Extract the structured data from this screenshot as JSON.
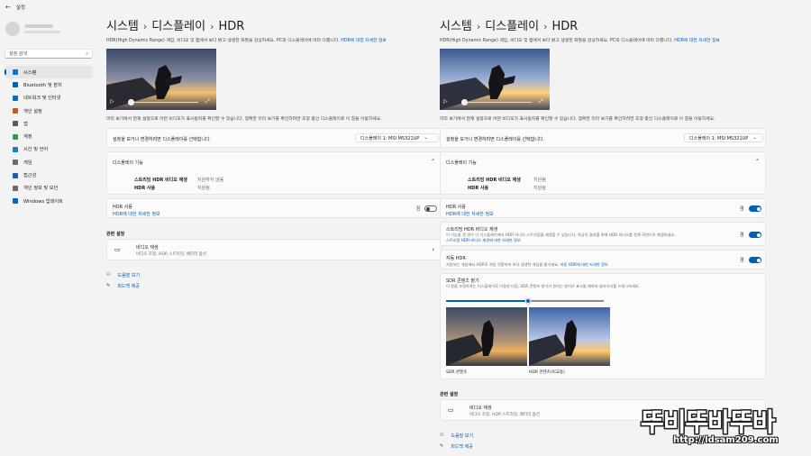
{
  "app": {
    "title": "설정"
  },
  "sidebar": {
    "search_placeholder": "설정 검색",
    "items": [
      {
        "label": "시스템",
        "icon": "system-icon",
        "color": "#0078d4"
      },
      {
        "label": "Bluetooth 및 장치",
        "icon": "bluetooth-icon",
        "color": "#0063b1"
      },
      {
        "label": "네트워크 및 인터넷",
        "icon": "network-icon",
        "color": "#0a6ebd"
      },
      {
        "label": "개인 설정",
        "icon": "brush-icon",
        "color": "#c85a1e"
      },
      {
        "label": "앱",
        "icon": "apps-icon",
        "color": "#5b5b5b"
      },
      {
        "label": "계정",
        "icon": "account-icon",
        "color": "#2e9d4f"
      },
      {
        "label": "시간 및 언어",
        "icon": "time-language-icon",
        "color": "#1a7fc1"
      },
      {
        "label": "게임",
        "icon": "gaming-icon",
        "color": "#6b6b6b"
      },
      {
        "label": "접근성",
        "icon": "accessibility-icon",
        "color": "#1f5fa8"
      },
      {
        "label": "개인 정보 및 보안",
        "icon": "shield-icon",
        "color": "#6b6b6b"
      },
      {
        "label": "Windows 업데이트",
        "icon": "windows-update-icon",
        "color": "#0067c0"
      }
    ]
  },
  "breadcrumb": {
    "a": "시스템",
    "b": "디스플레이",
    "c": "HDR"
  },
  "hdr_intro": "HDR(High Dynamic Range) 게임, 비디오 및 앱에서 보다 밝고 생생한 화질을 감상하세요. PC와 디스플레이에 따라 다릅니다.",
  "hdr_intro_link": "HDR에 대한 자세한 정보",
  "preview_note": "미리 보기에서 현재 설정으로 어떤 비디오가 표시될지를 확인할 수 있습니다. 정확한 미리 보기를 확인하려면 조정 중인 디스플레이로 이 창을 이동하세요.",
  "select_display": {
    "label": "설정을 보거나 변경하려면 디스플레이를 선택합니다.",
    "value": "디스플레이 1: MSI MS321UP"
  },
  "capabilities": {
    "title": "디스플레이 기능",
    "stream_label": "스트리밍 HDR 비디오 재생",
    "hdr_label": "HDR 사용",
    "left_stream_value": "지원하지 않음",
    "left_hdr_value": "지원됨",
    "right_stream_value": "지원됨",
    "right_hdr_value": "지원됨"
  },
  "use_hdr": {
    "title": "HDR 사용",
    "link": "HDR에 대한 자세한 정보"
  },
  "stream_hdr": {
    "title": "스트리밍 HDR 비디오 재생",
    "desc": "이 기능을 켠 경우 이 디스플레이에서 HDR 비디오 스트리밍을 재생할 수 있습니다. 최상의 결과를 위해 HDR 비디오를 전체 화면으로 재생하세요.",
    "link": "스트리밍 HDR 비디오 재생에 대한 자세한 정보"
  },
  "auto_hdr": {
    "title": "자동 HDR",
    "desc": "지원되는 게임에서 HDR로 자동 전환하여 보다 생생한 게임을 즐기세요.",
    "link": "자동 HDR에 대한 자세한 정보"
  },
  "sdr": {
    "title": "SDR 콘텐츠 밝기",
    "desc": "이 창을 조정하려는 디스플레이로 이동한 다음, SDR 콘텐츠 밝기가 원하는 밝기로 표시될 때까지 슬라이더를 드래그하세요.",
    "slider_value": 0.52,
    "sdr_caption": "SDR 콘텐츠",
    "hdr_caption": "HDR 콘텐츠(비교용)"
  },
  "related": {
    "heading": "관련 설정",
    "video_title": "비디오 재생",
    "video_sub": "비디오 조정, HDR 스트리밍, 배터리 옵션"
  },
  "help": {
    "get_help": "도움말 보기",
    "feedback": "피드백 제공"
  },
  "video": {
    "progress": 0.05
  },
  "watermark": {
    "text": "뚜비뚜바뚜바",
    "url": "http://ldsam209.com"
  },
  "colors": {
    "accent": "#005fb8"
  }
}
